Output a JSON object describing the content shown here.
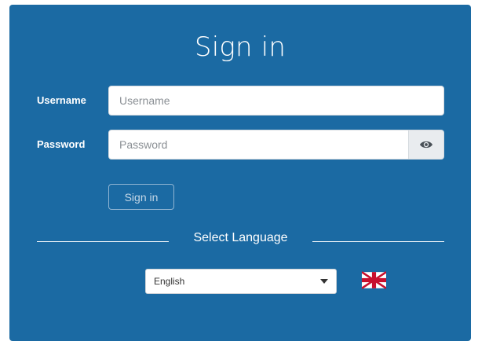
{
  "signin": {
    "title": "Sign in",
    "username_label": "Username",
    "username_placeholder": "Username",
    "username_value": "",
    "password_label": "Password",
    "password_placeholder": "Password",
    "password_value": "",
    "show_password_icon": "eye-icon",
    "submit_label": "Sign in"
  },
  "language": {
    "heading": "Select Language",
    "selected": "English",
    "flag_icon": "uk-flag-icon"
  },
  "colors": {
    "card_background": "#1b6aa3",
    "text": "#ffffff",
    "input_background": "#ffffff",
    "addon_background": "#e9ecef"
  }
}
